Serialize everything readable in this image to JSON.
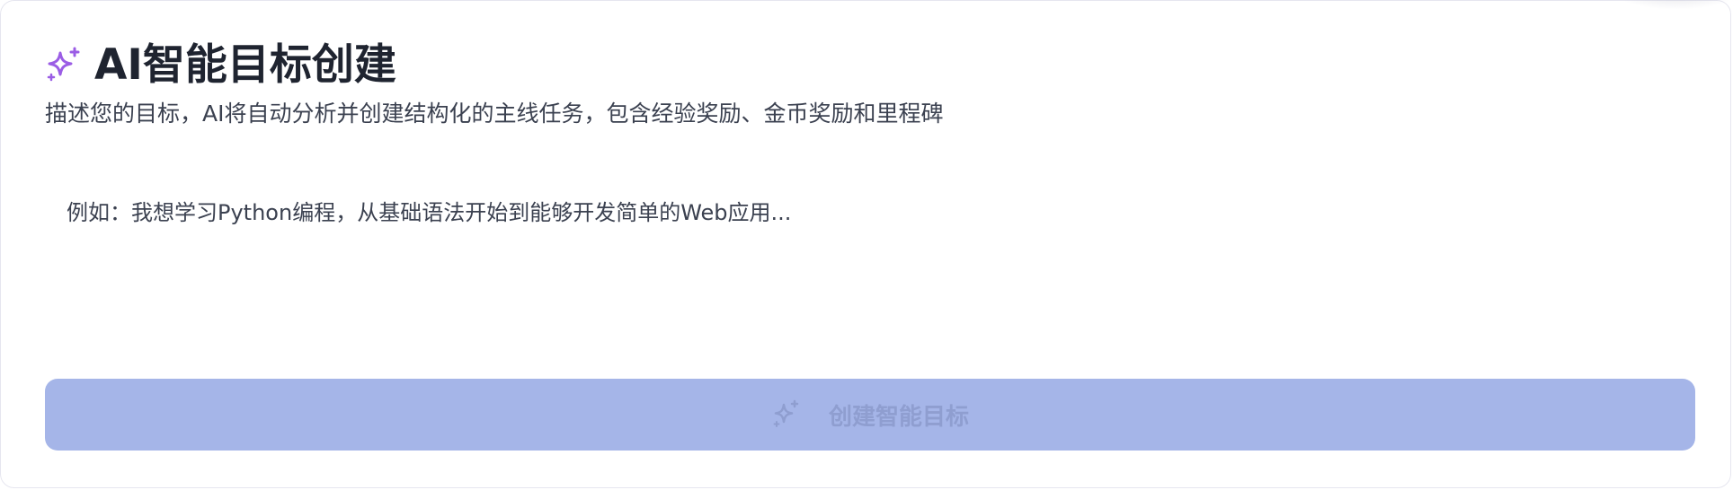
{
  "header": {
    "title": "AI智能目标创建",
    "title_icon": "sparkles-icon",
    "subtitle": "描述您的目标，AI将自动分析并创建结构化的主线任务，包含经验奖励、金币奖励和里程碑"
  },
  "goal_input": {
    "value": "",
    "placeholder": "例如：我想学习Python编程，从基础语法开始到能够开发简单的Web应用..."
  },
  "create_button": {
    "label": "创建智能目标",
    "icon": "sparkles-icon",
    "disabled": true
  },
  "colors": {
    "accent_purple": "#9b5de5",
    "button_bg": "#a5b5e8",
    "button_text": "#8f9ed0",
    "title_text": "#1f2430"
  }
}
